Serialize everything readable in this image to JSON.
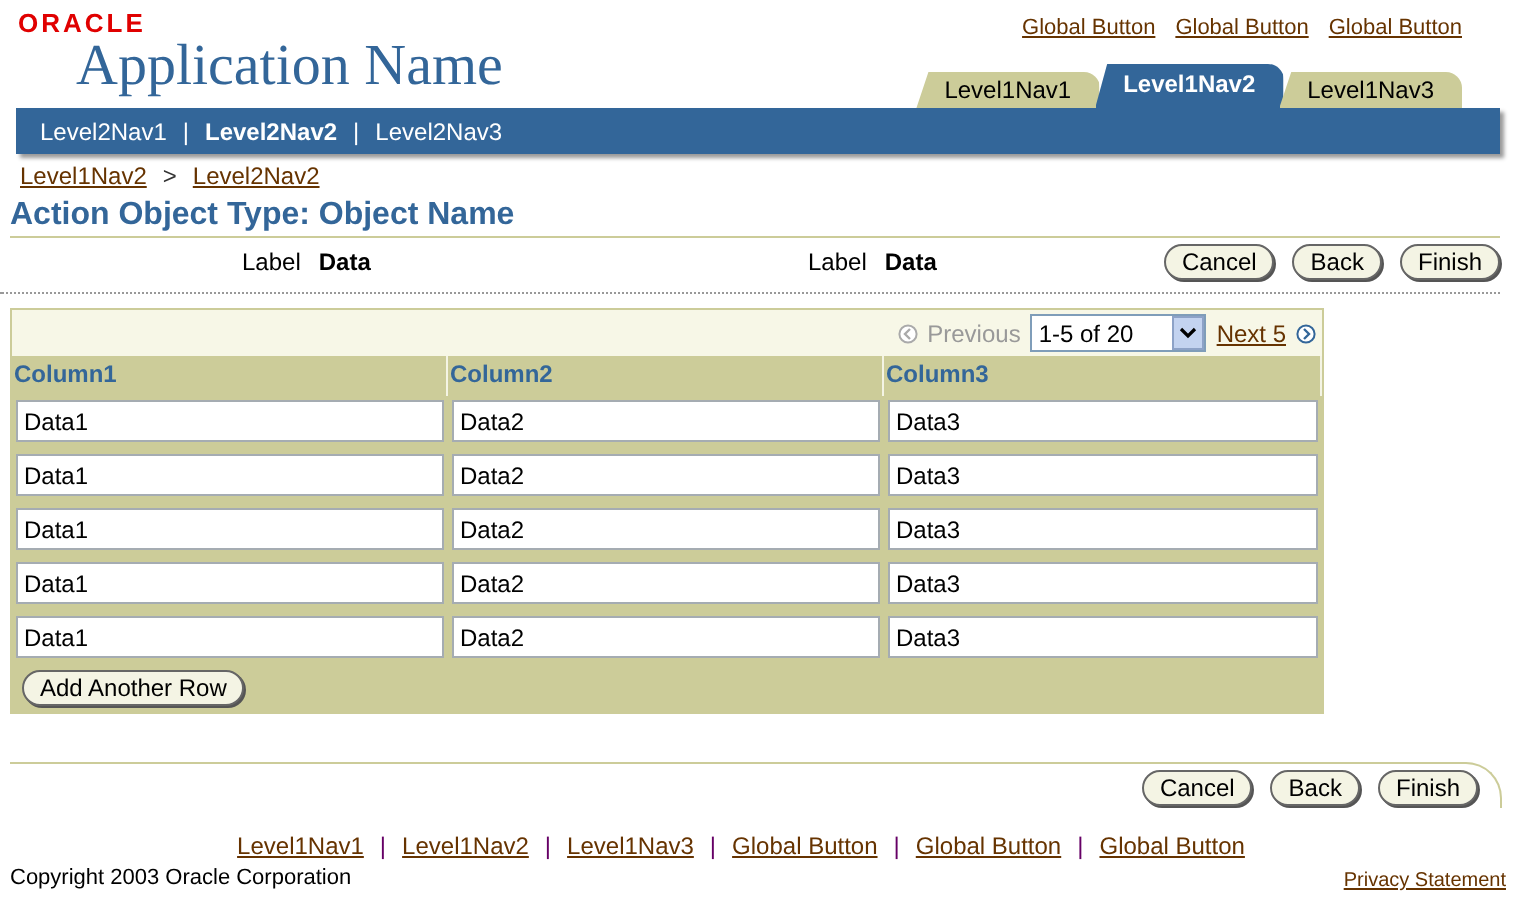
{
  "header": {
    "logo": "ORACLE",
    "app_name": "Application Name",
    "global_buttons": [
      "Global Button",
      "Global Button",
      "Global Button"
    ]
  },
  "tabs": [
    {
      "label": "Level1Nav1",
      "selected": false
    },
    {
      "label": "Level1Nav2",
      "selected": true
    },
    {
      "label": "Level1Nav3",
      "selected": false
    }
  ],
  "subnav": [
    {
      "label": "Level2Nav1",
      "selected": false
    },
    {
      "label": "Level2Nav2",
      "selected": true
    },
    {
      "label": "Level2Nav3",
      "selected": false
    }
  ],
  "subnav_separator": "|",
  "breadcrumbs": {
    "items": [
      "Level1Nav2",
      "Level2Nav2"
    ],
    "separator": ">"
  },
  "page_title": "Action Object Type: Object Name",
  "fields": [
    {
      "label": "Label",
      "value": "Data"
    },
    {
      "label": "Label",
      "value": "Data"
    }
  ],
  "top_buttons": [
    "Cancel",
    "Back",
    "Finish"
  ],
  "table": {
    "paging": {
      "previous": "Previous",
      "previous_disabled": true,
      "range": "1-5 of 20",
      "next": "Next 5"
    },
    "columns": [
      "Column1",
      "Column2",
      "Column3"
    ],
    "rows": [
      [
        "Data1",
        "Data2",
        "Data3"
      ],
      [
        "Data1",
        "Data2",
        "Data3"
      ],
      [
        "Data1",
        "Data2",
        "Data3"
      ],
      [
        "Data1",
        "Data2",
        "Data3"
      ],
      [
        "Data1",
        "Data2",
        "Data3"
      ]
    ],
    "add_button": "Add Another Row"
  },
  "bottom_buttons": [
    "Cancel",
    "Back",
    "Finish"
  ],
  "footer": {
    "links": [
      "Level1Nav1",
      "Level1Nav2",
      "Level1Nav3",
      "Global Button",
      "Global Button",
      "Global Button"
    ],
    "separator": "|",
    "copyright": "Copyright 2003 Oracle Corporation",
    "privacy": "Privacy Statement"
  }
}
